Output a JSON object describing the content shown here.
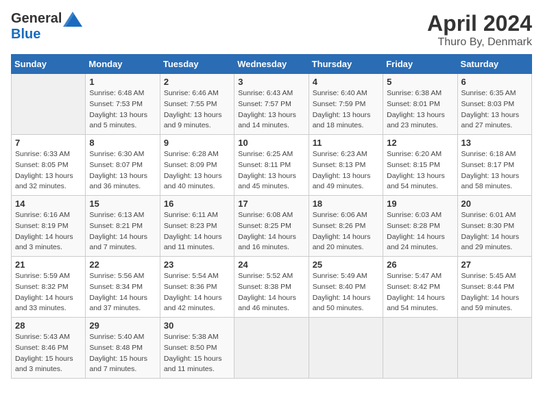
{
  "logo": {
    "general": "General",
    "blue": "Blue"
  },
  "title": "April 2024",
  "location": "Thuro By, Denmark",
  "days_header": [
    "Sunday",
    "Monday",
    "Tuesday",
    "Wednesday",
    "Thursday",
    "Friday",
    "Saturday"
  ],
  "weeks": [
    [
      {
        "day": "",
        "sunrise": "",
        "sunset": "",
        "daylight": ""
      },
      {
        "day": "1",
        "sunrise": "Sunrise: 6:48 AM",
        "sunset": "Sunset: 7:53 PM",
        "daylight": "Daylight: 13 hours and 5 minutes."
      },
      {
        "day": "2",
        "sunrise": "Sunrise: 6:46 AM",
        "sunset": "Sunset: 7:55 PM",
        "daylight": "Daylight: 13 hours and 9 minutes."
      },
      {
        "day": "3",
        "sunrise": "Sunrise: 6:43 AM",
        "sunset": "Sunset: 7:57 PM",
        "daylight": "Daylight: 13 hours and 14 minutes."
      },
      {
        "day": "4",
        "sunrise": "Sunrise: 6:40 AM",
        "sunset": "Sunset: 7:59 PM",
        "daylight": "Daylight: 13 hours and 18 minutes."
      },
      {
        "day": "5",
        "sunrise": "Sunrise: 6:38 AM",
        "sunset": "Sunset: 8:01 PM",
        "daylight": "Daylight: 13 hours and 23 minutes."
      },
      {
        "day": "6",
        "sunrise": "Sunrise: 6:35 AM",
        "sunset": "Sunset: 8:03 PM",
        "daylight": "Daylight: 13 hours and 27 minutes."
      }
    ],
    [
      {
        "day": "7",
        "sunrise": "Sunrise: 6:33 AM",
        "sunset": "Sunset: 8:05 PM",
        "daylight": "Daylight: 13 hours and 32 minutes."
      },
      {
        "day": "8",
        "sunrise": "Sunrise: 6:30 AM",
        "sunset": "Sunset: 8:07 PM",
        "daylight": "Daylight: 13 hours and 36 minutes."
      },
      {
        "day": "9",
        "sunrise": "Sunrise: 6:28 AM",
        "sunset": "Sunset: 8:09 PM",
        "daylight": "Daylight: 13 hours and 40 minutes."
      },
      {
        "day": "10",
        "sunrise": "Sunrise: 6:25 AM",
        "sunset": "Sunset: 8:11 PM",
        "daylight": "Daylight: 13 hours and 45 minutes."
      },
      {
        "day": "11",
        "sunrise": "Sunrise: 6:23 AM",
        "sunset": "Sunset: 8:13 PM",
        "daylight": "Daylight: 13 hours and 49 minutes."
      },
      {
        "day": "12",
        "sunrise": "Sunrise: 6:20 AM",
        "sunset": "Sunset: 8:15 PM",
        "daylight": "Daylight: 13 hours and 54 minutes."
      },
      {
        "day": "13",
        "sunrise": "Sunrise: 6:18 AM",
        "sunset": "Sunset: 8:17 PM",
        "daylight": "Daylight: 13 hours and 58 minutes."
      }
    ],
    [
      {
        "day": "14",
        "sunrise": "Sunrise: 6:16 AM",
        "sunset": "Sunset: 8:19 PM",
        "daylight": "Daylight: 14 hours and 3 minutes."
      },
      {
        "day": "15",
        "sunrise": "Sunrise: 6:13 AM",
        "sunset": "Sunset: 8:21 PM",
        "daylight": "Daylight: 14 hours and 7 minutes."
      },
      {
        "day": "16",
        "sunrise": "Sunrise: 6:11 AM",
        "sunset": "Sunset: 8:23 PM",
        "daylight": "Daylight: 14 hours and 11 minutes."
      },
      {
        "day": "17",
        "sunrise": "Sunrise: 6:08 AM",
        "sunset": "Sunset: 8:25 PM",
        "daylight": "Daylight: 14 hours and 16 minutes."
      },
      {
        "day": "18",
        "sunrise": "Sunrise: 6:06 AM",
        "sunset": "Sunset: 8:26 PM",
        "daylight": "Daylight: 14 hours and 20 minutes."
      },
      {
        "day": "19",
        "sunrise": "Sunrise: 6:03 AM",
        "sunset": "Sunset: 8:28 PM",
        "daylight": "Daylight: 14 hours and 24 minutes."
      },
      {
        "day": "20",
        "sunrise": "Sunrise: 6:01 AM",
        "sunset": "Sunset: 8:30 PM",
        "daylight": "Daylight: 14 hours and 29 minutes."
      }
    ],
    [
      {
        "day": "21",
        "sunrise": "Sunrise: 5:59 AM",
        "sunset": "Sunset: 8:32 PM",
        "daylight": "Daylight: 14 hours and 33 minutes."
      },
      {
        "day": "22",
        "sunrise": "Sunrise: 5:56 AM",
        "sunset": "Sunset: 8:34 PM",
        "daylight": "Daylight: 14 hours and 37 minutes."
      },
      {
        "day": "23",
        "sunrise": "Sunrise: 5:54 AM",
        "sunset": "Sunset: 8:36 PM",
        "daylight": "Daylight: 14 hours and 42 minutes."
      },
      {
        "day": "24",
        "sunrise": "Sunrise: 5:52 AM",
        "sunset": "Sunset: 8:38 PM",
        "daylight": "Daylight: 14 hours and 46 minutes."
      },
      {
        "day": "25",
        "sunrise": "Sunrise: 5:49 AM",
        "sunset": "Sunset: 8:40 PM",
        "daylight": "Daylight: 14 hours and 50 minutes."
      },
      {
        "day": "26",
        "sunrise": "Sunrise: 5:47 AM",
        "sunset": "Sunset: 8:42 PM",
        "daylight": "Daylight: 14 hours and 54 minutes."
      },
      {
        "day": "27",
        "sunrise": "Sunrise: 5:45 AM",
        "sunset": "Sunset: 8:44 PM",
        "daylight": "Daylight: 14 hours and 59 minutes."
      }
    ],
    [
      {
        "day": "28",
        "sunrise": "Sunrise: 5:43 AM",
        "sunset": "Sunset: 8:46 PM",
        "daylight": "Daylight: 15 hours and 3 minutes."
      },
      {
        "day": "29",
        "sunrise": "Sunrise: 5:40 AM",
        "sunset": "Sunset: 8:48 PM",
        "daylight": "Daylight: 15 hours and 7 minutes."
      },
      {
        "day": "30",
        "sunrise": "Sunrise: 5:38 AM",
        "sunset": "Sunset: 8:50 PM",
        "daylight": "Daylight: 15 hours and 11 minutes."
      },
      {
        "day": "",
        "sunrise": "",
        "sunset": "",
        "daylight": ""
      },
      {
        "day": "",
        "sunrise": "",
        "sunset": "",
        "daylight": ""
      },
      {
        "day": "",
        "sunrise": "",
        "sunset": "",
        "daylight": ""
      },
      {
        "day": "",
        "sunrise": "",
        "sunset": "",
        "daylight": ""
      }
    ]
  ]
}
